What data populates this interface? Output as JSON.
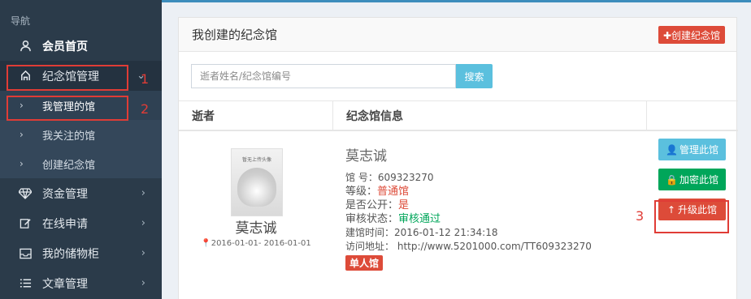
{
  "sidebar": {
    "header": "导航",
    "items": [
      {
        "label": "会员首页",
        "icon": "user-icon"
      },
      {
        "label": "纪念馆管理",
        "icon": "building-icon"
      },
      {
        "label": "资金管理",
        "icon": "diamond-icon"
      },
      {
        "label": "在线申请",
        "icon": "edit-icon"
      },
      {
        "label": "我的储物柜",
        "icon": "inbox-icon"
      },
      {
        "label": "文章管理",
        "icon": "list-icon"
      }
    ],
    "sub_items": [
      {
        "label": "我管理的馆"
      },
      {
        "label": "我关注的馆"
      },
      {
        "label": "创建纪念馆"
      }
    ]
  },
  "annotations": [
    "1",
    "2",
    "3"
  ],
  "panel": {
    "title": "我创建的纪念馆",
    "create_button": "✚创建纪念馆",
    "search_placeholder": "逝者姓名/纪念馆编号",
    "search_button": "搜索"
  },
  "table": {
    "headers": [
      "逝者",
      "纪念馆信息",
      ""
    ],
    "row": {
      "photo_caption": "暂无上传头像",
      "deceased_name": "莫志诚",
      "dates": "2016-01-01- 2016-01-01",
      "memorial_name": "莫志诚",
      "hall_number_label": "馆 号：",
      "hall_number": "609323270",
      "level_label": "等级：",
      "level": "普通馆",
      "public_label": "是否公开：",
      "public": "是",
      "review_label": "审核状态：",
      "review": "审核通过",
      "created_label": "建馆时间：",
      "created": "2016-01-12 21:34:18",
      "url_label": "访问地址：",
      "url": "http://www.5201000.com/TT609323270",
      "tag": "单人馆"
    },
    "actions": {
      "manage": "管理此馆",
      "lock": "加密此馆",
      "upgrade": "升级此馆"
    }
  },
  "colors": {
    "sidebar_bg": "#2b3b4a",
    "danger": "#dd4b39",
    "info": "#5bc0de",
    "success": "#00a65a",
    "highlight": "#e03c36"
  }
}
